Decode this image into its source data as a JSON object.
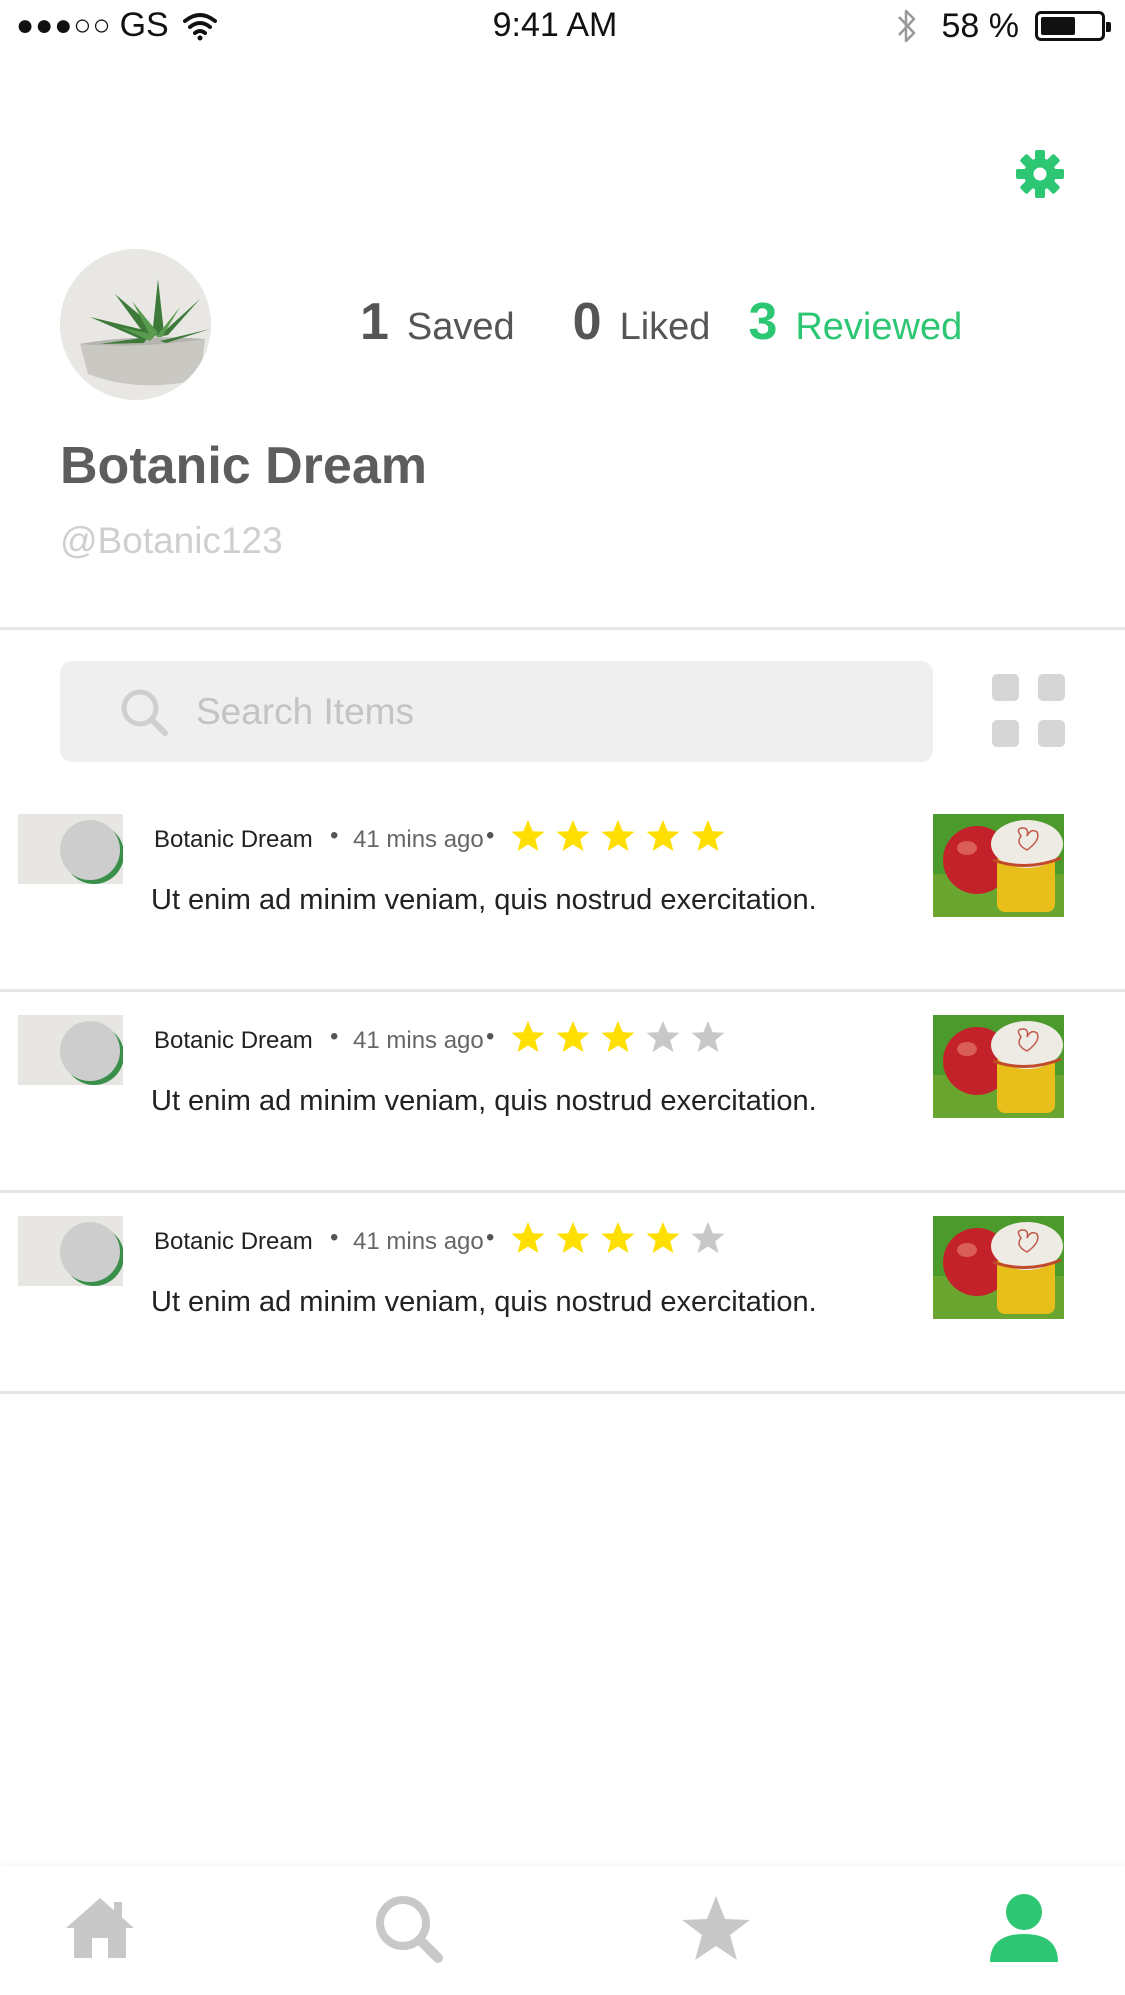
{
  "status_bar": {
    "signal": "●●●○○",
    "carrier": "GS",
    "time": "9:41 AM",
    "battery_percent": "58 %",
    "battery_level": 0.58
  },
  "colors": {
    "accent": "#2dc672",
    "star_filled": "#ffdf00",
    "star_empty": "#c8c8c8",
    "icon_gray": "#c8c8c8"
  },
  "profile": {
    "name": "Botanic Dream",
    "handle": "@Botanic123",
    "avatar_icon": "succulent-plant-photo"
  },
  "stats": [
    {
      "count": "1",
      "label": "Saved"
    },
    {
      "count": "0",
      "label": "Liked"
    },
    {
      "count": "3",
      "label": "Reviewed"
    }
  ],
  "search": {
    "placeholder": "Search Items"
  },
  "reviews": [
    {
      "author": "Botanic Dream",
      "time": "41 mins ago",
      "rating": 5,
      "text": "Ut enim ad minim veniam, quis nostrud exercitation."
    },
    {
      "author": "Botanic Dream",
      "time": "41 mins ago",
      "rating": 3,
      "text": "Ut enim ad minim veniam, quis nostrud exercitation."
    },
    {
      "author": "Botanic Dream",
      "time": "41 mins ago",
      "rating": 4,
      "text": "Ut enim ad minim veniam, quis nostrud exercitation."
    }
  ],
  "separator": "•",
  "tab_bar": [
    "home-icon",
    "search-icon",
    "star-icon",
    "profile-icon"
  ],
  "active_tab": "profile-icon"
}
